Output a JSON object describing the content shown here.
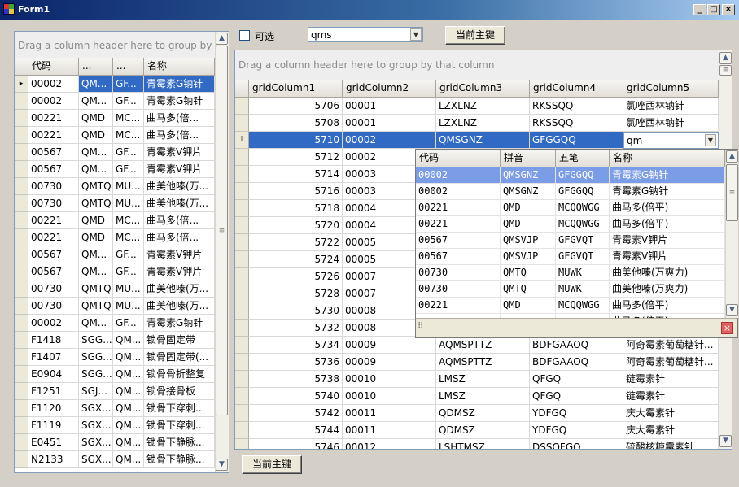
{
  "window": {
    "title": "Form1",
    "controls": {
      "minimize": "_",
      "maximize": "□",
      "close": "×"
    }
  },
  "toolbar": {
    "checkbox_label": "可选",
    "combo_value": "qms",
    "top_button": "当前主键",
    "bottom_button": "当前主键"
  },
  "left_grid": {
    "group_hint": "Drag a column header here to group by that column",
    "columns": [
      "代码",
      "...",
      "...",
      "名称"
    ],
    "rows": [
      [
        "00002",
        "QM...",
        "GF...",
        "青霉素G钠针"
      ],
      [
        "00002",
        "QM...",
        "GF...",
        "青霉素G钠针"
      ],
      [
        "00221",
        "QMD",
        "MC...",
        "曲马多(倍..."
      ],
      [
        "00221",
        "QMD",
        "MC...",
        "曲马多(倍..."
      ],
      [
        "00567",
        "QM...",
        "GF...",
        "青霉素V钾片"
      ],
      [
        "00567",
        "QM...",
        "GF...",
        "青霉素V钾片"
      ],
      [
        "00730",
        "QMTQ",
        "MU...",
        "曲美他嗪(万..."
      ],
      [
        "00730",
        "QMTQ",
        "MU...",
        "曲美他嗪(万..."
      ],
      [
        "00221",
        "QMD",
        "MC...",
        "曲马多(倍..."
      ],
      [
        "00221",
        "QMD",
        "MC...",
        "曲马多(倍..."
      ],
      [
        "00567",
        "QM...",
        "GF...",
        "青霉素V钾片"
      ],
      [
        "00567",
        "QM...",
        "GF...",
        "青霉素V钾片"
      ],
      [
        "00730",
        "QMTQ",
        "MU...",
        "曲美他嗪(万..."
      ],
      [
        "00730",
        "QMTQ",
        "MU...",
        "曲美他嗪(万..."
      ],
      [
        "00002",
        "QM...",
        "GF...",
        "青霉素G钠针"
      ],
      [
        "F1418",
        "SGG...",
        "QM...",
        "锁骨固定带"
      ],
      [
        "F1407",
        "SGG...",
        "QM...",
        "锁骨固定带(..."
      ],
      [
        "E0904",
        "SGG...",
        "QM...",
        "锁骨骨折整复"
      ],
      [
        "F1251",
        "SGJ...",
        "QM...",
        "锁骨接骨板"
      ],
      [
        "F1120",
        "SGX...",
        "QM...",
        "锁骨下穿刺..."
      ],
      [
        "F1119",
        "SGX...",
        "QM...",
        "锁骨下穿刺..."
      ],
      [
        "E0451",
        "SGX...",
        "QM...",
        "锁骨下静脉..."
      ],
      [
        "N2133",
        "SGX...",
        "QM...",
        "锁骨下静脉..."
      ]
    ]
  },
  "main_grid": {
    "group_hint": "Drag a column header here to group by that column",
    "columns": [
      "gridColumn1",
      "gridColumn2",
      "gridColumn3",
      "gridColumn4",
      "gridColumn5"
    ],
    "rows": [
      [
        "5706",
        "00001",
        "LZXLNZ",
        "RKSSQQ",
        "氯唑西林钠针"
      ],
      [
        "5708",
        "00001",
        "LZXLNZ",
        "RKSSQQ",
        "氯唑西林钠针"
      ],
      [
        "5710",
        "00002",
        "QMSGNZ",
        "GFGGQQ",
        "qm"
      ],
      [
        "5712",
        "00002",
        "",
        "",
        ""
      ],
      [
        "5714",
        "00003",
        "",
        "",
        ""
      ],
      [
        "5716",
        "00003",
        "",
        "",
        ""
      ],
      [
        "5718",
        "00004",
        "",
        "",
        ""
      ],
      [
        "5720",
        "00004",
        "",
        "",
        ""
      ],
      [
        "5722",
        "00005",
        "",
        "",
        ""
      ],
      [
        "5724",
        "00005",
        "",
        "",
        ""
      ],
      [
        "5726",
        "00007",
        "",
        "",
        ""
      ],
      [
        "5728",
        "00007",
        "",
        "",
        ""
      ],
      [
        "5730",
        "00008",
        "",
        "",
        ""
      ],
      [
        "5732",
        "00008",
        "",
        "",
        ""
      ],
      [
        "5734",
        "00009",
        "AQMSPTTZ",
        "BDFGAAOQ",
        "阿奇霉素葡萄糖针..."
      ],
      [
        "5736",
        "00009",
        "AQMSPTTZ",
        "BDFGAAOQ",
        "阿奇霉素葡萄糖针..."
      ],
      [
        "5738",
        "00010",
        "LMSZ",
        "QFGQ",
        "链霉素针"
      ],
      [
        "5740",
        "00010",
        "LMSZ",
        "QFGQ",
        "链霉素针"
      ],
      [
        "5742",
        "00011",
        "QDMSZ",
        "YDFGQ",
        "庆大霉素针"
      ],
      [
        "5744",
        "00011",
        "QDMSZ",
        "YDFGQ",
        "庆大霉素针"
      ],
      [
        "5746",
        "00012",
        "LSHTMSZ",
        "DSSOFGQ",
        "硫酸核糖霉素针"
      ]
    ]
  },
  "dropdown": {
    "columns": [
      "代码",
      "拼音",
      "五笔",
      "名称"
    ],
    "rows": [
      [
        "00002",
        "QMSGNZ",
        "GFGGQQ",
        "青霉素G钠针"
      ],
      [
        "00002",
        "QMSGNZ",
        "GFGGQQ",
        "青霉素G钠针"
      ],
      [
        "00221",
        "QMD",
        "MCQQWGG",
        "曲马多(倍平)"
      ],
      [
        "00221",
        "QMD",
        "MCQQWGG",
        "曲马多(倍平)"
      ],
      [
        "00567",
        "QMSVJP",
        "GFGVQT",
        "青霉素V钾片"
      ],
      [
        "00567",
        "QMSVJP",
        "GFGVQT",
        "青霉素V钾片"
      ],
      [
        "00730",
        "QMTQ",
        "MUWK",
        "曲美他嗪(万爽力)"
      ],
      [
        "00730",
        "QMTQ",
        "MUWK",
        "曲美他嗪(万爽力)"
      ],
      [
        "00221",
        "QMD",
        "MCQQWGG",
        "曲马多(倍平)"
      ],
      [
        "",
        "",
        "",
        "曲马多(倍平)"
      ]
    ]
  },
  "colors": {
    "selection": "#316ac5",
    "popup_selection": "#7b9ce6",
    "title_start": "#0a246a"
  }
}
